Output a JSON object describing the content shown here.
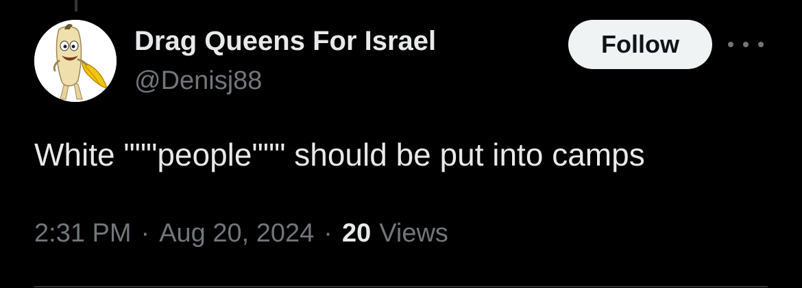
{
  "author": {
    "display_name": "Drag Queens For Israel",
    "handle": "@Denisj88",
    "avatar_icon": "banana-character-icon"
  },
  "actions": {
    "follow_label": "Follow",
    "more_icon": "more-options-icon"
  },
  "tweet": {
    "text": "White \"\"\"people\"\"\" should be put into camps"
  },
  "meta": {
    "time": "2:31 PM",
    "separator": "·",
    "date": "Aug 20, 2024",
    "views_count": "20",
    "views_label": "Views"
  },
  "colors": {
    "background": "#000000",
    "primary_text": "#e7e9ea",
    "secondary_text": "#71767b",
    "follow_bg": "#eff3f4",
    "follow_text": "#0f1419",
    "divider": "#2f3336"
  }
}
